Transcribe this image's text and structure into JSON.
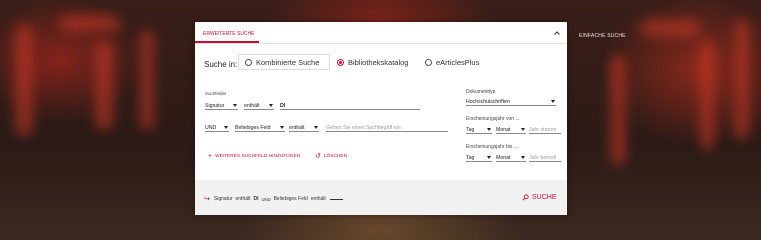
{
  "tabs": {
    "active_label": "ERWEITERTE SUCHE",
    "inactive_label": "EINFACHE SUCHE"
  },
  "suche_in": {
    "label": "Suche in:",
    "options": [
      "Kombinierte Suche",
      "Bibliothekskatalog",
      "eArticlesPlus"
    ],
    "selected": "Bibliothekskatalog"
  },
  "suchfelder": {
    "label": "Suchfelder",
    "row1": {
      "field": "Signatur",
      "operator": "enthält",
      "value": "DI"
    },
    "row2": {
      "bool": "UND",
      "field": "Beliebiges Feld",
      "operator": "enthält",
      "placeholder": "Geben Sie einen Suchbegriff ein"
    },
    "add_label": "WEITERES SUCHFELD HINZUFÜGEN",
    "delete_label": "LÖSCHEN"
  },
  "filters": {
    "doctype_label": "Dokumenttyp",
    "doctype_value": "Hochschulschriften",
    "from_label": "Erscheinungsjahr von ...",
    "to_label": "Erscheinungsjahr bis ...",
    "day": "Tag",
    "month": "Monat",
    "year_from_ph": "Jahr starten",
    "year_to_ph": "Jahr beendi"
  },
  "summary": {
    "part1_field": "Signatur",
    "part1_op": "enthält",
    "part1_value": "DI",
    "conj": "UND",
    "part2_field": "Beliebiges Feld",
    "part2_op": "enthält"
  },
  "search_button": "SUCHE",
  "colors": {
    "accent": "#c8102e"
  }
}
